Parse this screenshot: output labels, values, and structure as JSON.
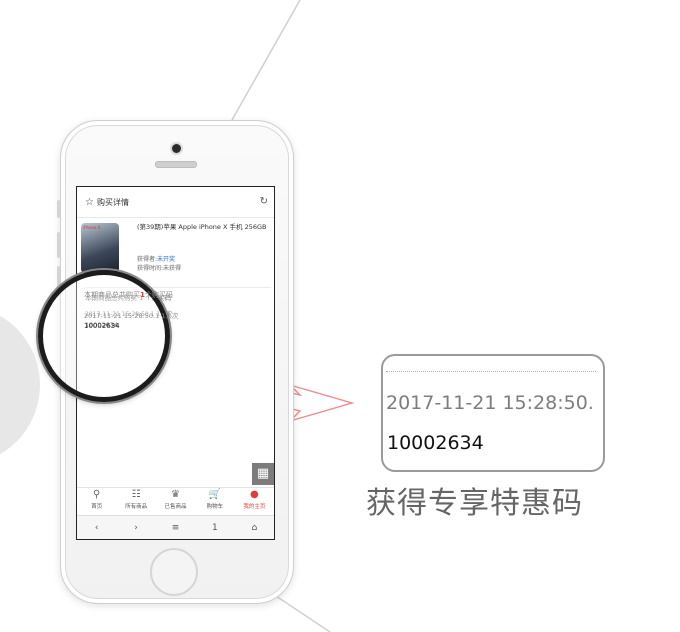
{
  "screen": {
    "header_title": "购买详情",
    "star_icon": "☆",
    "refresh_icon": "↻",
    "product": {
      "image_label": "iPhone X",
      "name": "(第39期)苹果 Apple iPhone X 手机 256GB",
      "winner_label": "获得者:",
      "winner_value": "未开奖",
      "time_label": "获得时间:",
      "time_value": "未获得"
    },
    "total_prefix": "本期商品总共购买",
    "total_count": "1",
    "total_suffix": "个购买码",
    "record": "2017-11-21 15:28:50.1 1人次",
    "code": "10002634",
    "grid_icon": "▦",
    "tabs": [
      {
        "icon": "⚲",
        "label": "首页",
        "active": false
      },
      {
        "icon": "☷",
        "label": "所有商品",
        "active": false
      },
      {
        "icon": "♛",
        "label": "已售商品",
        "active": false
      },
      {
        "icon": "🛒",
        "label": "购物车",
        "active": false
      },
      {
        "icon": "●",
        "label": "我的主页",
        "active": true
      }
    ],
    "browser": [
      "‹",
      "›",
      "≡",
      "1",
      "⌂"
    ]
  },
  "lens": {
    "line1_prefix": "本期商品总共购买",
    "line1_count": "1",
    "line1_suffix": "个购买码",
    "line2": "2017-11-21 15:28:50.1 1人次",
    "line3": "10002634"
  },
  "callout": {
    "time": "2017-11-21 15:28:50.",
    "code": "10002634"
  },
  "caption": "获得专享特惠码",
  "colors": {
    "accent_red": "#e23b3b",
    "link_blue": "#2a6fd6",
    "arrow_pink": "#f08a8a"
  }
}
